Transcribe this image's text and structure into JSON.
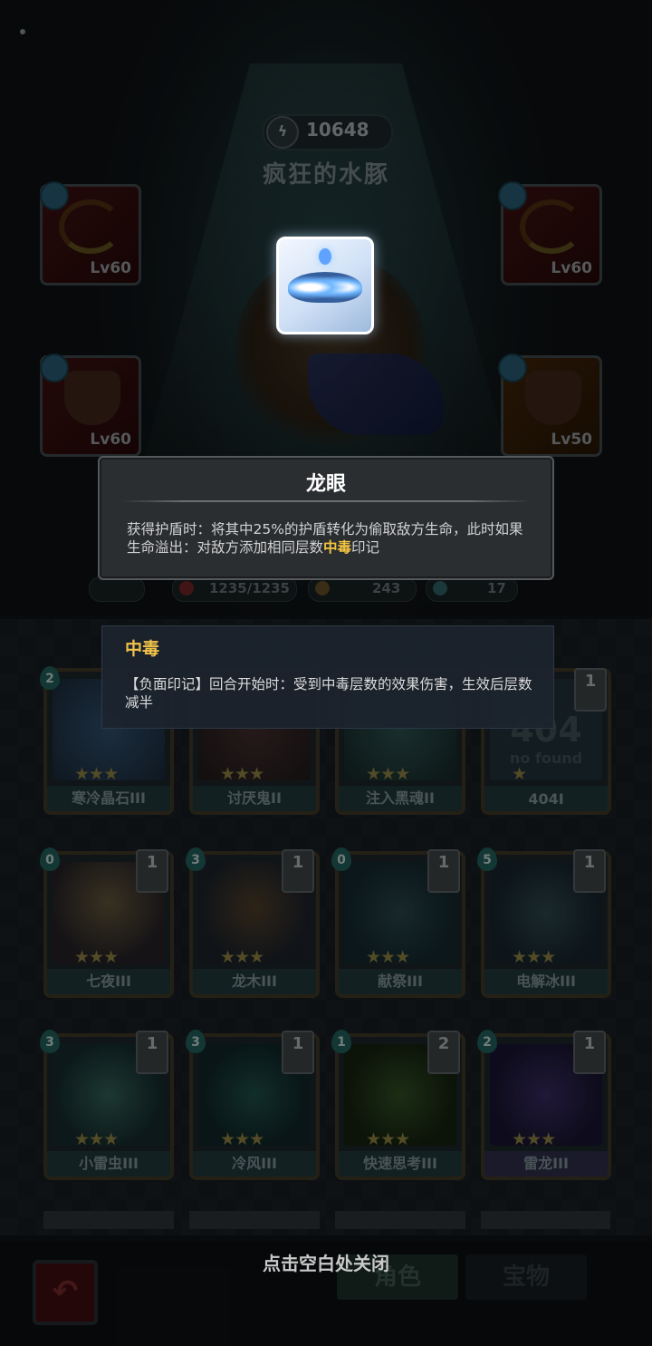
{
  "header": {
    "power_value": "10648",
    "hero_name": "疯狂的水豚"
  },
  "equipment": [
    {
      "level": "Lv60",
      "slot": "left-top"
    },
    {
      "level": "Lv60",
      "slot": "right-top"
    },
    {
      "level": "Lv60",
      "slot": "left-bottom"
    },
    {
      "level": "Lv50",
      "slot": "right-bottom"
    }
  ],
  "stats": {
    "hp": "1235/1235",
    "attack": "243",
    "energy": "17"
  },
  "tooltip": {
    "title": "龙眼",
    "body_before": "获得护盾时：将其中25%的护盾转化为偷取敌方生命，此时如果生命溢出：对敌方添加相同层数",
    "body_highlight": "中毒",
    "body_after": "印记"
  },
  "subtooltip": {
    "title": "中毒",
    "body": "【负面印记】回合开始时：受到中毒层数的效果伤害，生效后层数减半"
  },
  "deck": {
    "cards": [
      {
        "name": "寒冷晶石III",
        "cost": "2",
        "count": ""
      },
      {
        "name": "讨厌鬼II",
        "cost": "",
        "count": ""
      },
      {
        "name": "注入黑魂II",
        "cost": "",
        "count": ""
      },
      {
        "name": "404I",
        "cost": "",
        "count": "1"
      },
      {
        "name": "七夜III",
        "cost": "0",
        "count": "1"
      },
      {
        "name": "龙木III",
        "cost": "3",
        "count": "1"
      },
      {
        "name": "献祭III",
        "cost": "0",
        "count": "1"
      },
      {
        "name": "电解冰III",
        "cost": "5",
        "count": "1"
      },
      {
        "name": "小雷虫III",
        "cost": "3",
        "count": "1"
      },
      {
        "name": "冷风III",
        "cost": "3",
        "count": "1"
      },
      {
        "name": "快速思考III",
        "cost": "1",
        "count": "2"
      },
      {
        "name": "雷龙III",
        "cost": "2",
        "count": "1"
      }
    ],
    "stars": "★★★",
    "card_404_art_text": "404",
    "card_404_art_subtext": "no found"
  },
  "footer": {
    "close_hint": "点击空白处关闭",
    "tab_character": "角色",
    "tab_treasure": "宝物"
  },
  "colors": {
    "highlight": "#f4c542",
    "tooltip_bg": "#2b2e31",
    "subtooltip_bg": "#1c242e"
  }
}
